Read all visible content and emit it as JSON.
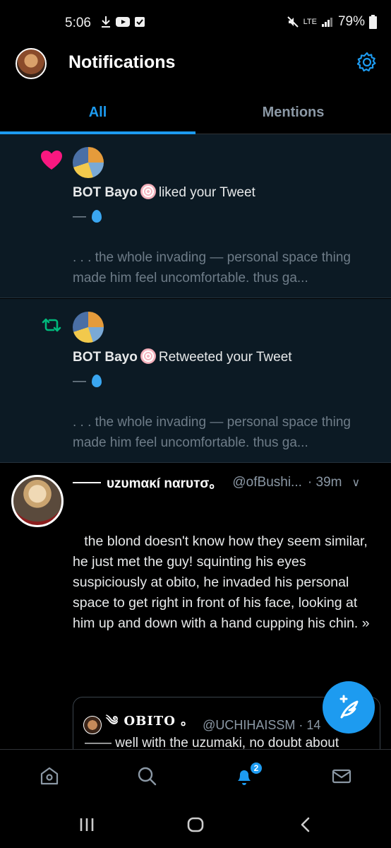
{
  "status_bar": {
    "time": "5:06",
    "network": "LTE",
    "battery": "79%"
  },
  "header": {
    "title": "Notifications"
  },
  "tabs": [
    {
      "label": "All"
    },
    {
      "label": "Mentions"
    }
  ],
  "notifications": [
    {
      "type": "like",
      "user": "BOT Bayo",
      "action": "liked your Tweet",
      "dash": "—",
      "snippet": ". . . the whole invading — personal space thing made him feel uncomfortable. thus ga..."
    },
    {
      "type": "retweet",
      "user": "BOT Bayo",
      "action": "Retweeted your Tweet",
      "dash": "—",
      "snippet": ". . . the whole invading — personal space thing made him feel uncomfortable. thus ga..."
    }
  ],
  "tweet": {
    "name": "υzυmακí nαrυтσ。",
    "handle": "@ofBushi...",
    "time": "· 39m",
    "body": "   the blond doesn't know how they seem similar, he just met the guy! squinting his eyes suspiciously at obito, he invaded his personal space to get right in front of his face, looking at him up and down with a hand cupping his chin. »",
    "quote": {
      "name": "OBITO 。",
      "handle": "@UCHIHAISSM · 14",
      "text": "—— well with the uzumaki, no doubt about"
    }
  },
  "bottom_nav": {
    "notification_badge": "2"
  },
  "colors": {
    "accent": "#1d9bf0",
    "like": "#f91880",
    "retweet": "#00ba7c",
    "card_bg": "#0c1a24"
  }
}
